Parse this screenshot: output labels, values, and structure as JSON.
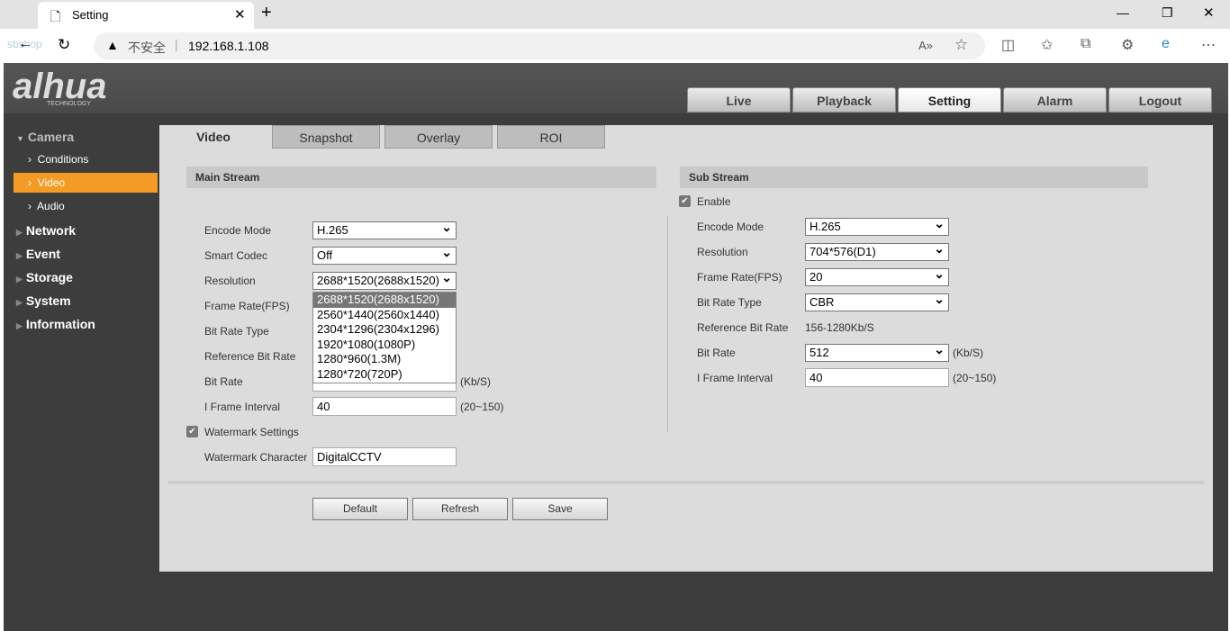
{
  "browser": {
    "tab_title": "Setting",
    "security_label": "不安全",
    "url": "192.168.1.108",
    "watermark": "sbshop"
  },
  "brand": {
    "logo": "alhua",
    "sub": "TECHNOLOGY"
  },
  "nav": [
    "Live",
    "Playback",
    "Setting",
    "Alarm",
    "Logout"
  ],
  "sidebar": {
    "camera": "Camera",
    "camera_items": [
      "Conditions",
      "Video",
      "Audio"
    ],
    "sections": [
      "Network",
      "Event",
      "Storage",
      "System",
      "Information"
    ]
  },
  "tabs": [
    "Video",
    "Snapshot",
    "Overlay",
    "ROI"
  ],
  "main": {
    "title": "Main Stream",
    "encode_mode": {
      "label": "Encode Mode",
      "value": "H.265"
    },
    "smart_codec": {
      "label": "Smart Codec",
      "value": "Off"
    },
    "resolution": {
      "label": "Resolution",
      "value": "2688*1520(2688x1520)",
      "options": [
        "2688*1520(2688x1520)",
        "2560*1440(2560x1440)",
        "2304*1296(2304x1296)",
        "1920*1080(1080P)",
        "1280*960(1.3M)",
        "1280*720(720P)"
      ]
    },
    "frame_rate": {
      "label": "Frame Rate(FPS)"
    },
    "bit_rate_type": {
      "label": "Bit Rate Type"
    },
    "reference_bit_rate": {
      "label": "Reference Bit Rate"
    },
    "bit_rate": {
      "label": "Bit Rate",
      "unit": "(Kb/S)"
    },
    "i_frame": {
      "label": "I Frame Interval",
      "value": "40",
      "range": "(20~150)"
    },
    "watermark_settings": "Watermark Settings",
    "watermark_char": {
      "label": "Watermark Character",
      "value": "DigitalCCTV"
    }
  },
  "sub": {
    "title": "Sub Stream",
    "enable": "Enable",
    "encode_mode": {
      "label": "Encode Mode",
      "value": "H.265"
    },
    "resolution": {
      "label": "Resolution",
      "value": "704*576(D1)"
    },
    "frame_rate": {
      "label": "Frame Rate(FPS)",
      "value": "20"
    },
    "bit_rate_type": {
      "label": "Bit Rate Type",
      "value": "CBR"
    },
    "reference_bit_rate": {
      "label": "Reference Bit Rate",
      "value": "156-1280Kb/S"
    },
    "bit_rate": {
      "label": "Bit Rate",
      "value": "512",
      "unit": "(Kb/S)"
    },
    "i_frame": {
      "label": "I Frame Interval",
      "value": "40",
      "range": "(20~150)"
    }
  },
  "buttons": {
    "default": "Default",
    "refresh": "Refresh",
    "save": "Save"
  }
}
